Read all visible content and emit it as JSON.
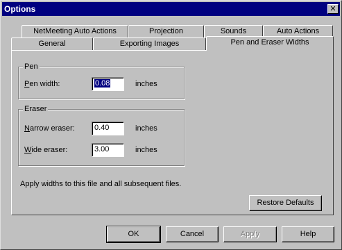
{
  "window": {
    "title": "Options",
    "close_glyph": "✕"
  },
  "tabs": {
    "row1": [
      "NetMeeting Auto Actions",
      "Projection",
      "Sounds",
      "Auto Actions"
    ],
    "row2": [
      "General",
      "Exporting Images",
      "Pen and Eraser Widths"
    ],
    "active": "Pen and Eraser Widths"
  },
  "pen": {
    "title": "Pen",
    "width_label": "Pen width:",
    "width_value": "0.08",
    "unit": "inches"
  },
  "eraser": {
    "title": "Eraser",
    "narrow_label": "Narrow eraser:",
    "narrow_value": "0.40",
    "narrow_unit": "inches",
    "wide_label": "Wide eraser:",
    "wide_value": "3.00",
    "wide_unit": "inches"
  },
  "apply_note": "Apply widths to this file and all subsequent files.",
  "restore_label": "Restore Defaults",
  "buttons": {
    "ok": "OK",
    "cancel": "Cancel",
    "apply": "Apply",
    "help": "Help"
  },
  "colors": {
    "face": "#c0c0c0",
    "title_bar": "#000080",
    "selection": "#000080"
  }
}
